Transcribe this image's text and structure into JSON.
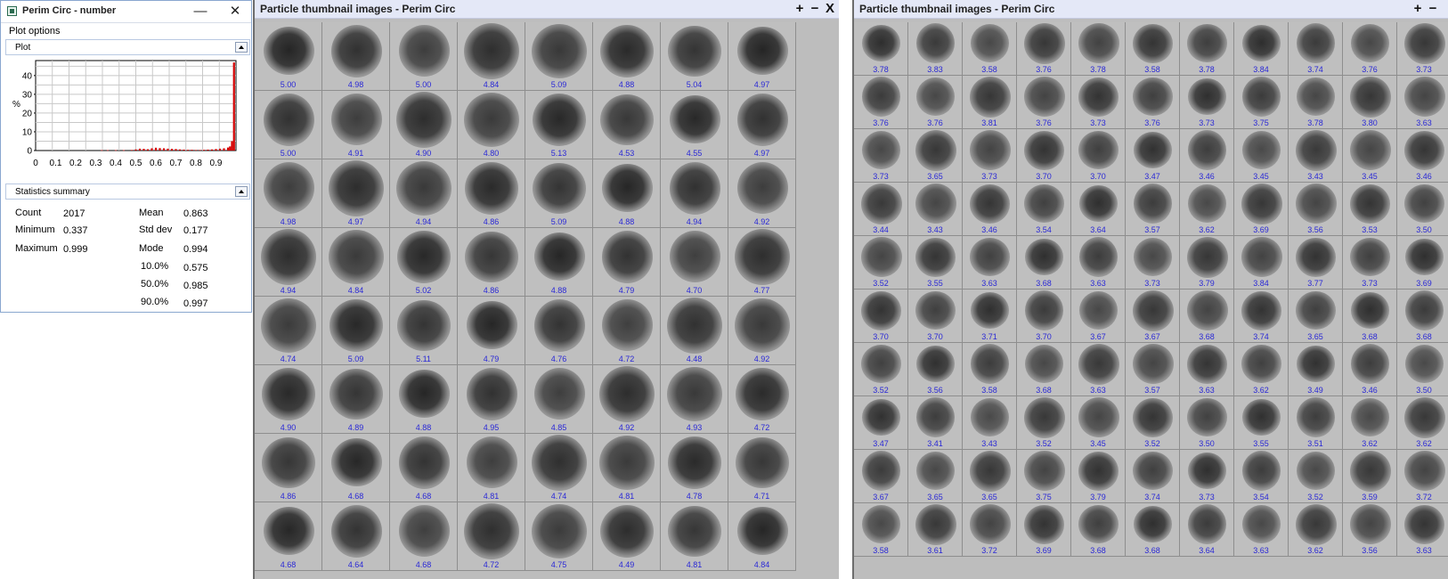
{
  "stats_window": {
    "title": "Perim Circ - number",
    "minimize": "—",
    "close": "✕",
    "plot_options_label": "Plot options",
    "plot_panel_label": "Plot",
    "stats_panel_label": "Statistics summary",
    "y_axis_label": "%",
    "y_ticks": [
      "40",
      "30",
      "20",
      "10",
      "0"
    ],
    "x_ticks": [
      "0",
      "0.1",
      "0.2",
      "0.3",
      "0.4",
      "0.5",
      "0.6",
      "0.7",
      "0.8",
      "0.9"
    ],
    "bar_color": "#d40000",
    "stats": {
      "count_label": "Count",
      "count_value": "2017",
      "min_label": "Minimum",
      "min_value": "0.337",
      "max_label": "Maximum",
      "max_value": "0.999",
      "mean_label": "Mean",
      "mean_value": "0.863",
      "std_label": "Std dev",
      "std_value": "0.177",
      "mode_label": "Mode",
      "mode_value": "0.994",
      "p10_label": "10.0%",
      "p10_value": "0.575",
      "p50_label": "50.0%",
      "p50_value": "0.985",
      "p90_label": "90.0%",
      "p90_value": "0.997"
    }
  },
  "chart_data": {
    "type": "bar",
    "title": "",
    "xlabel": "",
    "ylabel": "%",
    "xlim": [
      0,
      1
    ],
    "ylim": [
      0,
      48
    ],
    "x_ticks": [
      0,
      0.1,
      0.2,
      0.3,
      0.4,
      0.5,
      0.6,
      0.7,
      0.8,
      0.9
    ],
    "y_ticks": [
      0,
      10,
      20,
      30,
      40
    ],
    "grid": true,
    "bins": [
      [
        0.33,
        0.2
      ],
      [
        0.36,
        0.2
      ],
      [
        0.4,
        0.2
      ],
      [
        0.44,
        0.2
      ],
      [
        0.48,
        0.3
      ],
      [
        0.5,
        0.6
      ],
      [
        0.52,
        1.0
      ],
      [
        0.54,
        0.9
      ],
      [
        0.56,
        0.7
      ],
      [
        0.58,
        1.2
      ],
      [
        0.6,
        1.5
      ],
      [
        0.62,
        1.3
      ],
      [
        0.64,
        1.2
      ],
      [
        0.66,
        1.0
      ],
      [
        0.68,
        0.9
      ],
      [
        0.7,
        0.8
      ],
      [
        0.72,
        0.6
      ],
      [
        0.74,
        0.5
      ],
      [
        0.76,
        0.4
      ],
      [
        0.78,
        0.4
      ],
      [
        0.8,
        0.3
      ],
      [
        0.82,
        0.3
      ],
      [
        0.84,
        0.4
      ],
      [
        0.86,
        0.5
      ],
      [
        0.88,
        0.6
      ],
      [
        0.9,
        0.8
      ],
      [
        0.92,
        1.0
      ],
      [
        0.94,
        1.2
      ],
      [
        0.96,
        1.6
      ],
      [
        0.97,
        2.2
      ],
      [
        0.98,
        5.0
      ],
      [
        0.99,
        47.0
      ]
    ]
  },
  "grid_left": {
    "title": "Particle thumbnail images - Perim Circ",
    "btn_plus": "+",
    "btn_minus": "−",
    "btn_close": "X",
    "rows": [
      [
        "5.00",
        "4.98",
        "5.00",
        "4.84",
        "5.09",
        "4.88",
        "5.04",
        "4.97"
      ],
      [
        "5.00",
        "4.91",
        "4.90",
        "4.80",
        "5.13",
        "4.53",
        "4.55",
        "4.97"
      ],
      [
        "4.98",
        "4.97",
        "4.94",
        "4.86",
        "5.09",
        "4.88",
        "4.94",
        "4.92"
      ],
      [
        "4.94",
        "4.84",
        "5.02",
        "4.86",
        "4.88",
        "4.79",
        "4.70",
        "4.77"
      ],
      [
        "4.74",
        "5.09",
        "5.11",
        "4.79",
        "4.76",
        "4.72",
        "4.48",
        "4.92"
      ],
      [
        "4.90",
        "4.89",
        "4.88",
        "4.95",
        "4.85",
        "4.92",
        "4.93",
        "4.72"
      ],
      [
        "4.86",
        "4.68",
        "4.68",
        "4.81",
        "4.74",
        "4.81",
        "4.78",
        "4.71"
      ],
      [
        "4.68",
        "4.64",
        "4.68",
        "4.72",
        "4.75",
        "4.49",
        "4.81",
        "4.84"
      ]
    ]
  },
  "grid_right": {
    "title": "Particle thumbnail images - Perim Circ",
    "btn_plus": "+",
    "btn_minus": "−",
    "rows": [
      [
        "3.78",
        "3.83",
        "3.58",
        "3.76",
        "3.78",
        "3.58",
        "3.78",
        "3.84",
        "3.74",
        "3.76",
        "3.73"
      ],
      [
        "3.76",
        "3.76",
        "3.81",
        "3.76",
        "3.73",
        "3.76",
        "3.73",
        "3.75",
        "3.78",
        "3.80",
        "3.63"
      ],
      [
        "3.73",
        "3.65",
        "3.73",
        "3.70",
        "3.70",
        "3.47",
        "3.46",
        "3.45",
        "3.43",
        "3.45",
        "3.46"
      ],
      [
        "3.44",
        "3.43",
        "3.46",
        "3.54",
        "3.64",
        "3.57",
        "3.62",
        "3.69",
        "3.56",
        "3.53",
        "3.50"
      ],
      [
        "3.52",
        "3.55",
        "3.63",
        "3.68",
        "3.63",
        "3.73",
        "3.79",
        "3.84",
        "3.77",
        "3.73",
        "3.69"
      ],
      [
        "3.70",
        "3.70",
        "3.71",
        "3.70",
        "3.67",
        "3.67",
        "3.68",
        "3.74",
        "3.65",
        "3.68",
        "3.68"
      ],
      [
        "3.52",
        "3.56",
        "3.58",
        "3.68",
        "3.63",
        "3.57",
        "3.63",
        "3.62",
        "3.49",
        "3.46",
        "3.50"
      ],
      [
        "3.47",
        "3.41",
        "3.43",
        "3.52",
        "3.45",
        "3.52",
        "3.50",
        "3.55",
        "3.51",
        "3.62",
        "3.62"
      ],
      [
        "3.67",
        "3.65",
        "3.65",
        "3.75",
        "3.79",
        "3.74",
        "3.73",
        "3.54",
        "3.52",
        "3.59",
        "3.72"
      ],
      [
        "3.58",
        "3.61",
        "3.72",
        "3.69",
        "3.68",
        "3.68",
        "3.64",
        "3.63",
        "3.62",
        "3.56",
        "3.63"
      ]
    ]
  }
}
